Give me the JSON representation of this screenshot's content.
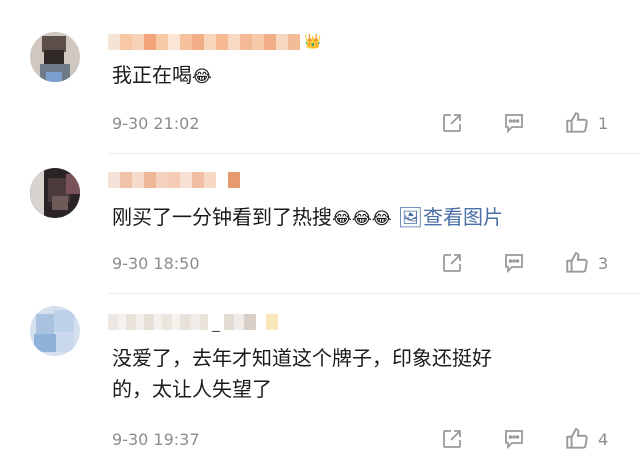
{
  "comments": [
    {
      "text": "我正在喝",
      "text_emoji": "😂",
      "time": "9-30 21:02",
      "likes": "1",
      "name_badge": "👑"
    },
    {
      "text": "刚买了一分钟看到了热搜",
      "text_emoji": "😂😂😂",
      "image_link_icon": "🖼",
      "image_link_label": "查看图片",
      "time": "9-30 18:50",
      "likes": "3"
    },
    {
      "text_line1": "没爱了，去年才知道这个牌子，印象还挺好",
      "text_line2": "的，太让人失望了",
      "time": "9-30 19:37",
      "likes": "4",
      "name_suffix": "_"
    }
  ],
  "icons": [
    "share-icon",
    "comment-icon",
    "like-icon"
  ],
  "colors": {
    "meta": "#8c8c8c",
    "link": "#4a6fa5",
    "divider": "#ececec"
  }
}
